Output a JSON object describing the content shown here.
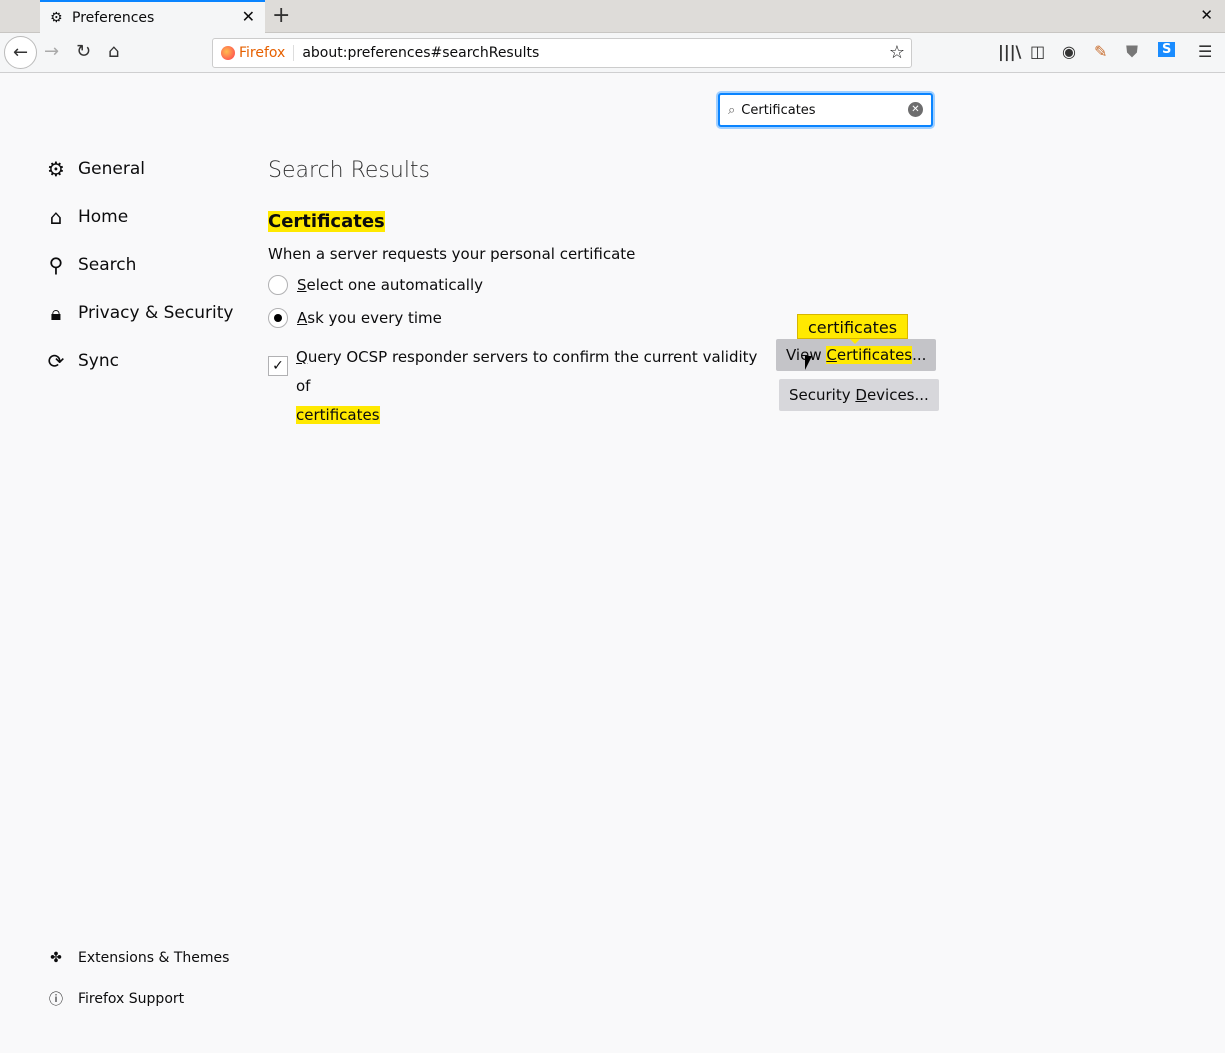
{
  "tab": {
    "title": "Preferences",
    "icon": "gear-icon"
  },
  "url": {
    "identity": "Firefox",
    "address": "about:preferences#searchResults"
  },
  "toolbar_icons": [
    "library-icon",
    "sidebar-icon",
    "account-icon",
    "extension-icon",
    "ublock-icon",
    "s-extension-icon",
    "menu-icon"
  ],
  "search": {
    "value": "Certificates"
  },
  "sidebar": {
    "items": [
      {
        "label": "General",
        "icon": "gear-icon"
      },
      {
        "label": "Home",
        "icon": "home-icon"
      },
      {
        "label": "Search",
        "icon": "search-icon"
      },
      {
        "label": "Privacy & Security",
        "icon": "lock-icon"
      },
      {
        "label": "Sync",
        "icon": "sync-icon"
      }
    ],
    "footer": [
      {
        "label": "Extensions & Themes",
        "icon": "puzzle-icon"
      },
      {
        "label": "Firefox Support",
        "icon": "help-icon"
      }
    ]
  },
  "main": {
    "title": "Search Results",
    "section": "Certificates",
    "prompt": "When a server requests your personal certificate",
    "radio1": {
      "accesskey": "S",
      "rest": "elect one automatically",
      "selected": false
    },
    "radio2": {
      "accesskey": "A",
      "rest": "sk you every time",
      "selected": true
    },
    "ocsp": {
      "accesskey": "Q",
      "rest": "uery OCSP responder servers to confirm the current validity of",
      "highlight": "certificates",
      "checked": true
    },
    "view_btn": {
      "pre": "View ",
      "accesskey": "C",
      "rest": "ertificates",
      "post": "..."
    },
    "devices_btn": {
      "pre": "Security ",
      "accesskey": "D",
      "rest": "evices..."
    },
    "tooltip": "certificates"
  },
  "colors": {
    "highlight": "#ffe900",
    "accent": "#0a84ff"
  }
}
